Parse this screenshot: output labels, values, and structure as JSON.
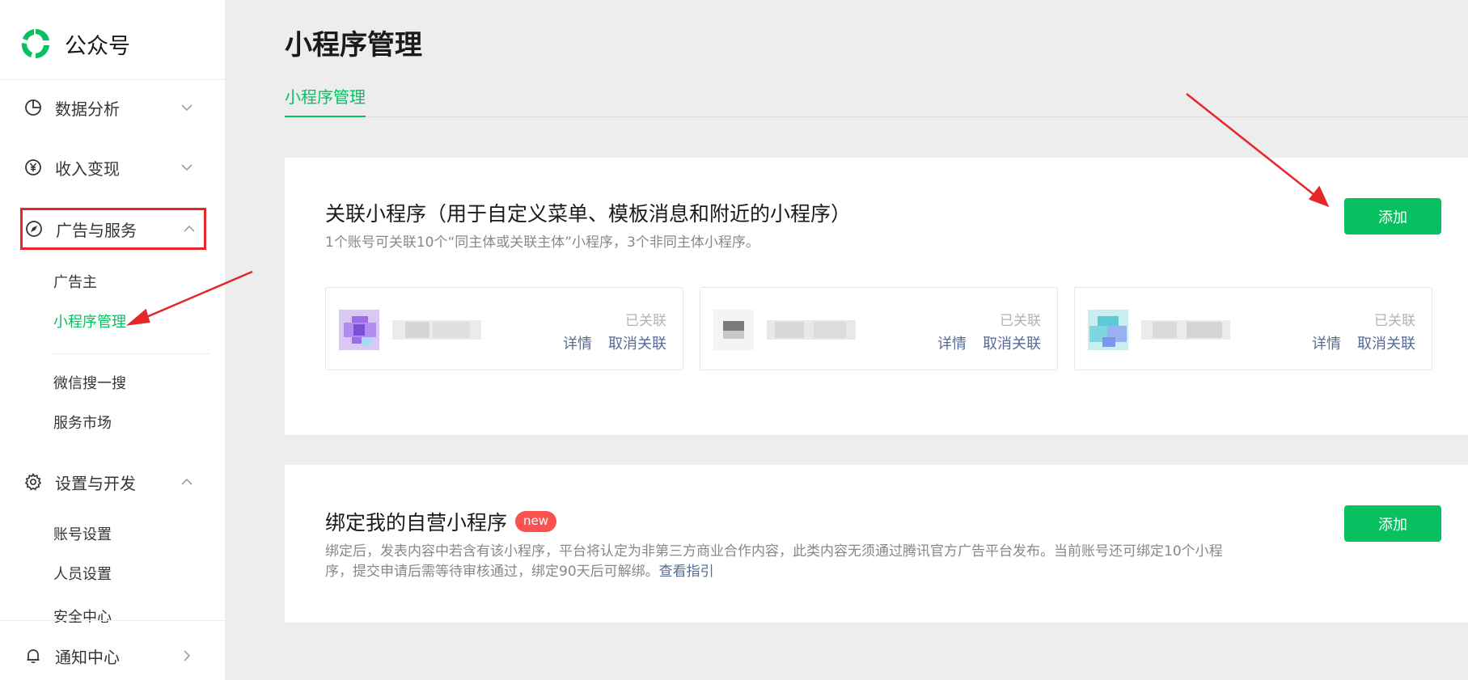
{
  "brand": {
    "name": "公众号",
    "color": "#07c160"
  },
  "sidebar": {
    "groups": [
      {
        "label": "数据分析",
        "icon": "pie-chart-icon",
        "expanded": false
      },
      {
        "label": "收入变现",
        "icon": "yen-icon",
        "expanded": false
      },
      {
        "label": "广告与服务",
        "icon": "compass-icon",
        "expanded": true,
        "highlighted": true
      },
      {
        "label": "设置与开发",
        "icon": "gear-icon",
        "expanded": true
      },
      {
        "label": "通知中心",
        "icon": "bell-icon",
        "expanded": false
      }
    ],
    "ads_items": [
      "广告主",
      "小程序管理",
      "微信搜一搜",
      "服务市场"
    ],
    "settings_items": [
      "账号设置",
      "人员设置",
      "安全中心"
    ],
    "active_item": "小程序管理"
  },
  "main": {
    "page_title": "小程序管理",
    "tabs": [
      {
        "label": "小程序管理",
        "active": true
      }
    ],
    "linked_section": {
      "title": "关联小程序（用于自定义菜单、模板消息和附近的小程序）",
      "desc": "1个账号可关联10个“同主体或关联主体”小程序，3个非同主体小程序。",
      "add_label": "添加",
      "items": [
        {
          "status": "已关联",
          "detail": "详情",
          "unlink": "取消关联"
        },
        {
          "status": "已关联",
          "detail": "详情",
          "unlink": "取消关联"
        },
        {
          "status": "已关联",
          "detail": "详情",
          "unlink": "取消关联"
        }
      ]
    },
    "bind_section": {
      "title": "绑定我的自营小程序",
      "badge": "new",
      "desc_line1": "绑定后，发表内容中若含有该小程序，平台将认定为非第三方商业合作内容，此类内容无须通过腾讯官方广告平台发布。当前账号还可绑定10个小程",
      "desc_line2": "序，提交申请后需等待审核通过，绑定90天后可解绑。",
      "guide_link": "查看指引",
      "add_label": "添加"
    }
  },
  "colors": {
    "accent": "#07c160",
    "link": "#576b95",
    "highlight_box": "#e5262b",
    "badge": "#fa5151"
  }
}
